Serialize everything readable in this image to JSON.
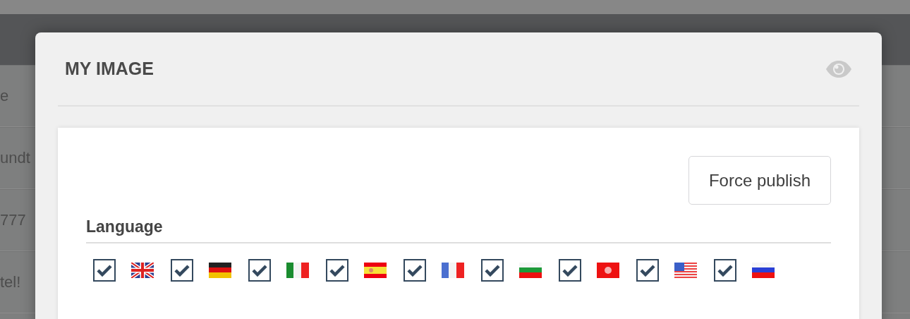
{
  "background_rows": [
    {
      "text": "e"
    },
    {
      "text": "undt"
    },
    {
      "text": "777"
    },
    {
      "text": "tel!"
    }
  ],
  "modal": {
    "title": "MY IMAGE",
    "force_publish_button": "Force publish",
    "section_title": "Language",
    "languages": [
      {
        "kind": "gb",
        "checked": true
      },
      {
        "kind": "de",
        "checked": true
      },
      {
        "kind": "it",
        "checked": true
      },
      {
        "kind": "es",
        "checked": true
      },
      {
        "kind": "fr",
        "checked": true
      },
      {
        "kind": "bg",
        "checked": true
      },
      {
        "kind": "hk",
        "checked": true
      },
      {
        "kind": "us",
        "checked": true
      },
      {
        "kind": "ru",
        "checked": true
      }
    ]
  }
}
